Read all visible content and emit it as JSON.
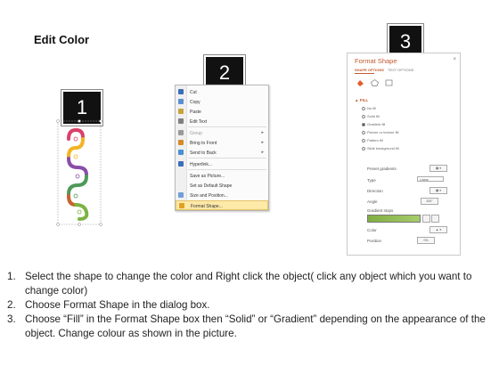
{
  "title": "Edit Color",
  "badges": {
    "step1": "1",
    "step2": "2",
    "step3": "3"
  },
  "context_menu": {
    "items": [
      {
        "label": "Cut",
        "icon": "scissors-icon",
        "dim": false,
        "arrow": false
      },
      {
        "label": "Copy",
        "icon": "copy-icon",
        "dim": false,
        "arrow": false
      },
      {
        "label": "Paste",
        "icon": "paste-icon",
        "dim": false,
        "arrow": false
      },
      {
        "label": "Edit Text",
        "icon": "edit-text-icon",
        "dim": false,
        "arrow": false
      },
      {
        "label": "Group",
        "icon": "group-icon",
        "dim": true,
        "arrow": true
      },
      {
        "label": "Bring to Front",
        "icon": "bring-front-icon",
        "dim": false,
        "arrow": true
      },
      {
        "label": "Send to Back",
        "icon": "send-back-icon",
        "dim": false,
        "arrow": true
      },
      {
        "label": "Hyperlink...",
        "icon": "hyperlink-icon",
        "dim": false,
        "arrow": false
      },
      {
        "label": "Save as Picture...",
        "icon": "",
        "dim": false,
        "arrow": false
      },
      {
        "label": "Set as Default Shape",
        "icon": "",
        "dim": false,
        "arrow": false
      },
      {
        "label": "Size and Position...",
        "icon": "size-position-icon",
        "dim": false,
        "arrow": false
      },
      {
        "label": "Format Shape...",
        "icon": "format-shape-icon",
        "dim": false,
        "arrow": false
      }
    ]
  },
  "format_pane": {
    "title": "Format Shape",
    "close": "×",
    "tab_active": "SHAPE OPTIONS",
    "tab_other": "TEXT OPTIONS",
    "fill_header": "▲ FILL",
    "fill_options": [
      {
        "label": "No fill",
        "on": false
      },
      {
        "label": "Solid fill",
        "on": false
      },
      {
        "label": "Gradient fill",
        "on": true
      },
      {
        "label": "Picture or texture fill",
        "on": false
      },
      {
        "label": "Pattern fill",
        "on": false
      },
      {
        "label": "Slide background fill",
        "on": false
      }
    ],
    "preset_gradients": "Preset gradients",
    "type_label": "Type",
    "type_value": "Linear",
    "direction_label": "Direction",
    "angle_label": "Angle",
    "angle_value": "200°",
    "gradient_stops": "Gradient stops",
    "color_label": "Color",
    "position_label": "Position",
    "position_value": "0%"
  },
  "instructions": [
    {
      "num": "1.",
      "text": "Select the shape to change the color and Right click the object( click any object which you want to change color)"
    },
    {
      "num": "2.",
      "text": "Choose Format Shape in the dialog box."
    },
    {
      "num": "3.",
      "text": "Choose “Fill” in the Format Shape box then “Solid” or “Gradient” depending on the appearance of the object. Change colour as shown in the picture."
    }
  ],
  "colors": {
    "accent": "#c55a2c",
    "highlight": "#fde9a8",
    "spiral": [
      "#d9416b",
      "#f2b325",
      "#8a4ea8",
      "#4e9a58",
      "#c8612f",
      "#7cb342"
    ]
  }
}
